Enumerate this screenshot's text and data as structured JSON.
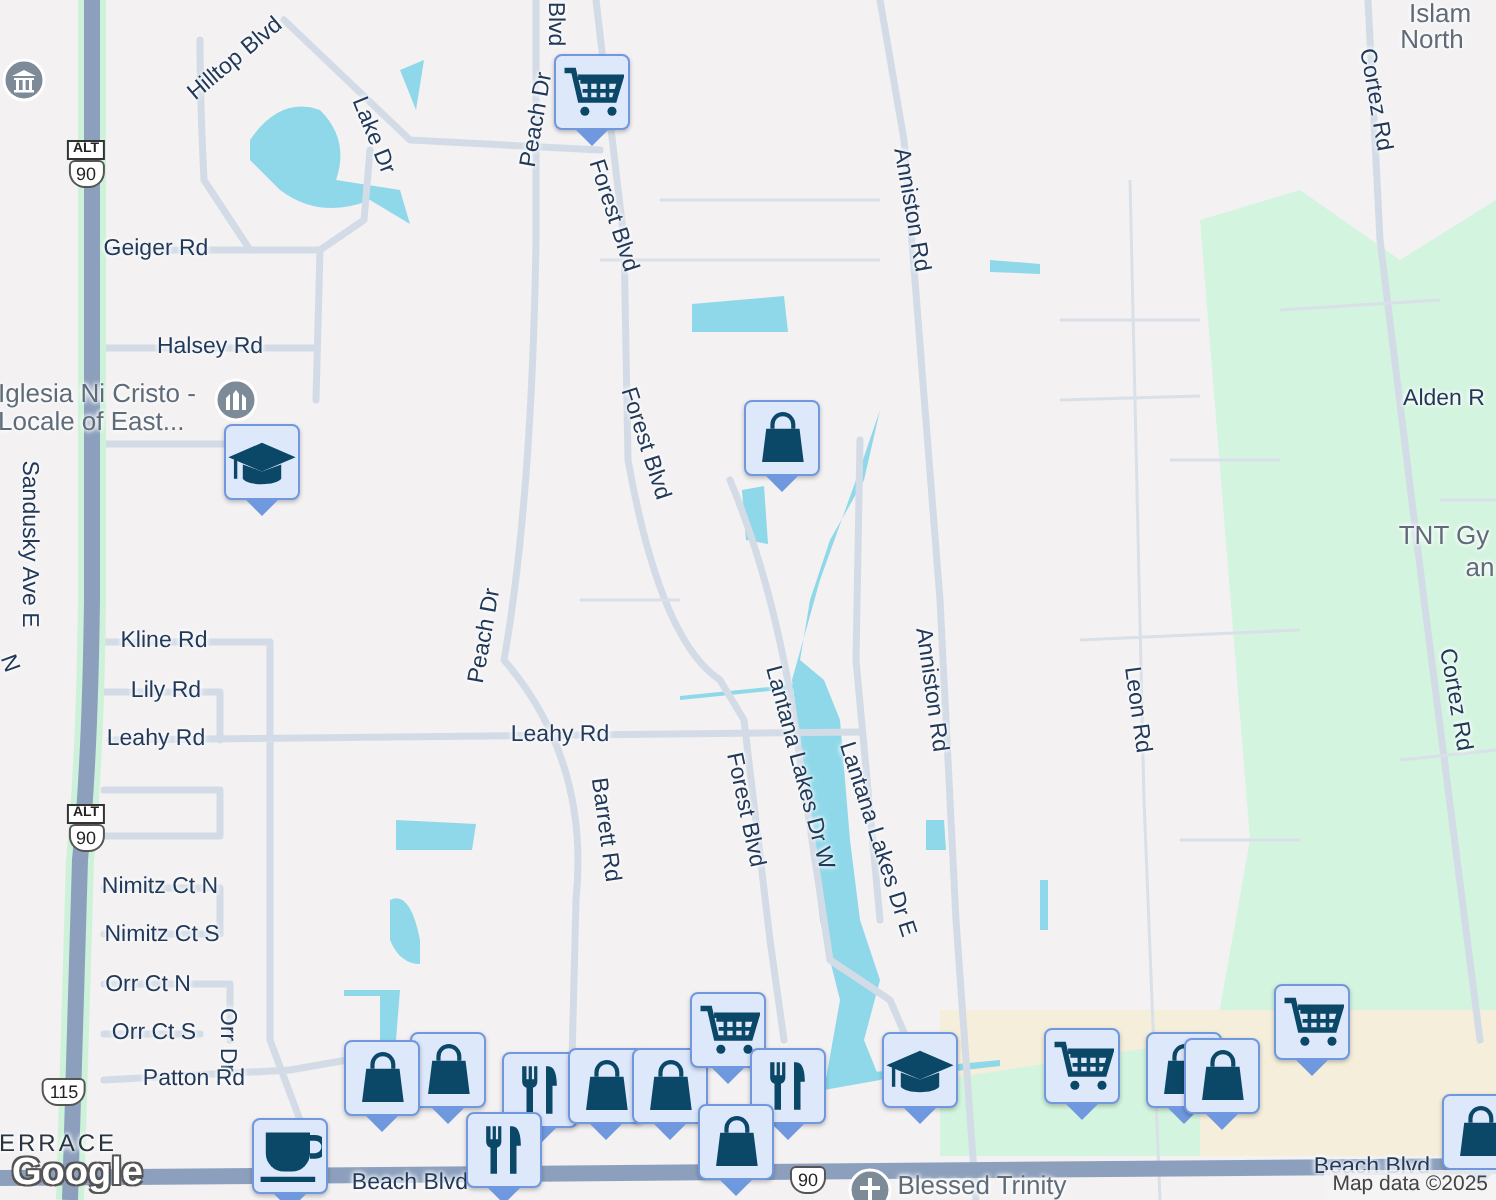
{
  "map": {
    "labels": [
      {
        "text": "Hilltop Blvd",
        "kind": "road"
      },
      {
        "text": "Lake Dr",
        "kind": "road"
      },
      {
        "text": "Blvd",
        "kind": "road"
      },
      {
        "text": "Peach Dr",
        "kind": "road"
      },
      {
        "text": "Forest Blvd",
        "kind": "road"
      },
      {
        "text": "Geiger Rd",
        "kind": "road"
      },
      {
        "text": "Halsey Rd",
        "kind": "road"
      },
      {
        "text": "Iglesia Ni Cristo - Locale of East...",
        "kind": "place"
      },
      {
        "text": "Forest Blvd",
        "kind": "road"
      },
      {
        "text": "Sandusky Ave E",
        "kind": "road"
      },
      {
        "text": "N",
        "kind": "road"
      },
      {
        "text": "Anniston Rd",
        "kind": "road"
      },
      {
        "text": "Cortez Rd",
        "kind": "road"
      },
      {
        "text": "Islam",
        "kind": "place"
      },
      {
        "text": "North",
        "kind": "place"
      },
      {
        "text": "Alden R",
        "kind": "road"
      },
      {
        "text": "TNT Gy",
        "kind": "place"
      },
      {
        "text": "an",
        "kind": "place"
      },
      {
        "text": "Kline Rd",
        "kind": "road"
      },
      {
        "text": "Lily Rd",
        "kind": "road"
      },
      {
        "text": "Leahy Rd",
        "kind": "road"
      },
      {
        "text": "Peach Dr",
        "kind": "road"
      },
      {
        "text": "Leahy Rd",
        "kind": "road"
      },
      {
        "text": "Barrett Rd",
        "kind": "road"
      },
      {
        "text": "Forest Blvd",
        "kind": "road"
      },
      {
        "text": "Lantana Lakes Dr W",
        "kind": "road"
      },
      {
        "text": "Lantana Lakes Dr E",
        "kind": "road"
      },
      {
        "text": "Anniston Rd",
        "kind": "road"
      },
      {
        "text": "Leon Rd",
        "kind": "road"
      },
      {
        "text": "Cortez Rd",
        "kind": "road"
      },
      {
        "text": "Nimitz Ct N",
        "kind": "road"
      },
      {
        "text": "Nimitz Ct S",
        "kind": "road"
      },
      {
        "text": "Orr Ct N",
        "kind": "road"
      },
      {
        "text": "Orr Ct S",
        "kind": "road"
      },
      {
        "text": "Orr Dr",
        "kind": "road"
      },
      {
        "text": "Patton Rd",
        "kind": "road"
      },
      {
        "text": "ERRACE",
        "kind": "area"
      },
      {
        "text": "Beach Blvd",
        "kind": "road"
      },
      {
        "text": "Blessed Trinity",
        "kind": "place"
      },
      {
        "text": "Beach Blvd",
        "kind": "road"
      }
    ],
    "shields": [
      {
        "top": "ALT",
        "number": "90"
      },
      {
        "top": "ALT",
        "number": "90"
      },
      {
        "number": "115"
      },
      {
        "number": "90"
      }
    ],
    "place_icons": [
      {
        "kind": "bank"
      },
      {
        "kind": "landmark"
      },
      {
        "kind": "church"
      }
    ],
    "pins": [
      {
        "kind": "cart"
      },
      {
        "kind": "cap"
      },
      {
        "kind": "bag"
      },
      {
        "kind": "bag"
      },
      {
        "kind": "bag"
      },
      {
        "kind": "fork"
      },
      {
        "kind": "bag"
      },
      {
        "kind": "bag"
      },
      {
        "kind": "cart"
      },
      {
        "kind": "fork"
      },
      {
        "kind": "cup"
      },
      {
        "kind": "fork"
      },
      {
        "kind": "bag"
      },
      {
        "kind": "cap"
      },
      {
        "kind": "cart"
      },
      {
        "kind": "bag"
      },
      {
        "kind": "bag"
      },
      {
        "kind": "cart"
      },
      {
        "kind": "bag"
      }
    ],
    "logo": "Google",
    "attribution": "Map data ©2025"
  }
}
